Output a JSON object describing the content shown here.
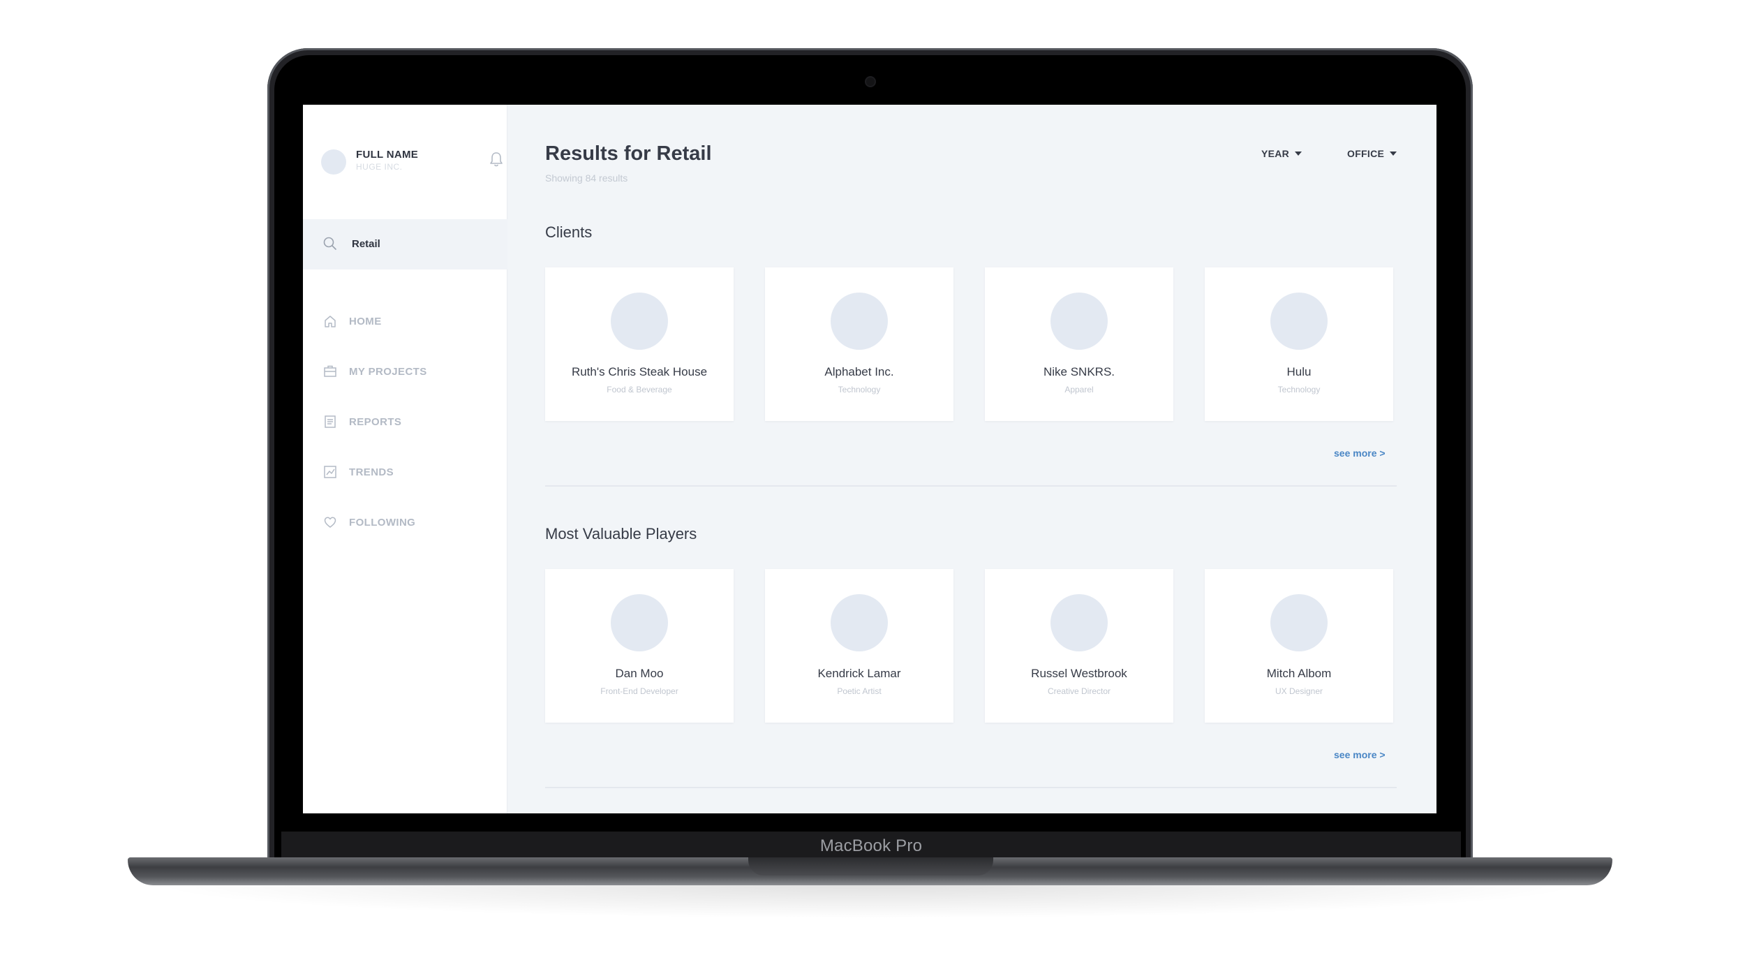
{
  "device": {
    "label": "MacBook Pro"
  },
  "sidebar": {
    "user": {
      "name": "FULL NAME",
      "org": "HUGE INC."
    },
    "search": {
      "value": "Retail"
    },
    "nav": [
      {
        "label": "HOME",
        "icon": "home-icon"
      },
      {
        "label": "MY PROJECTS",
        "icon": "briefcase-icon"
      },
      {
        "label": "REPORTS",
        "icon": "document-icon"
      },
      {
        "label": "TRENDS",
        "icon": "chart-icon"
      },
      {
        "label": "FOLLOWING",
        "icon": "heart-icon"
      }
    ]
  },
  "header": {
    "title": "Results for Retail",
    "subtitle": "Showing 84 results",
    "filters": [
      "YEAR",
      "OFFICE"
    ]
  },
  "clients": {
    "title": "Clients",
    "see_more": "see more  >",
    "items": [
      {
        "name": "Ruth's Chris Steak House",
        "sub": "Food & Beverage"
      },
      {
        "name": "Alphabet Inc.",
        "sub": "Technology"
      },
      {
        "name": "Nike SNKRS.",
        "sub": "Apparel"
      },
      {
        "name": "Hulu",
        "sub": "Technology"
      }
    ]
  },
  "players": {
    "title": "Most Valuable Players",
    "see_more": "see more  >",
    "items": [
      {
        "name": "Dan Moo",
        "sub": "Front-End Developer"
      },
      {
        "name": "Kendrick Lamar",
        "sub": "Poetic Artist"
      },
      {
        "name": "Russel Westbrook",
        "sub": "Creative Director"
      },
      {
        "name": "Mitch Albom",
        "sub": "UX Designer"
      }
    ]
  },
  "colors": {
    "accent": "#4a86c5",
    "background": "#f2f5f8",
    "text": "#363b47"
  }
}
